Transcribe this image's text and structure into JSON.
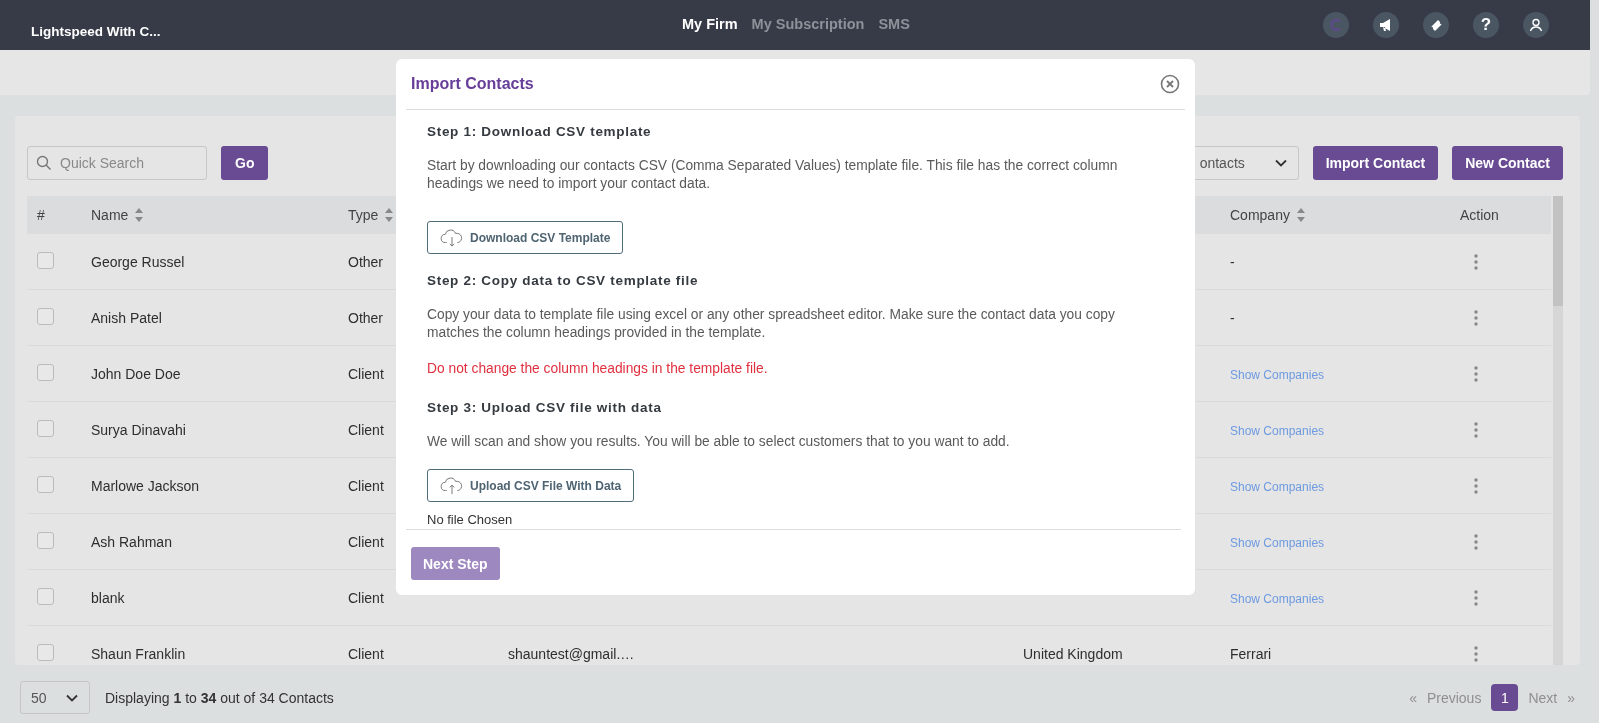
{
  "top_bar": {
    "brand": "Lightspeed With C...",
    "nav": [
      {
        "label": "My Firm",
        "selected": true
      },
      {
        "label": "My Subscription",
        "selected": false
      },
      {
        "label": "SMS",
        "selected": false
      }
    ],
    "help_glyph": "?"
  },
  "toolbar": {
    "search": {
      "placeholder": "Quick Search"
    },
    "go": "Go",
    "filter": "ontacts",
    "buttons": [
      "Import Contact",
      "New Contact"
    ]
  },
  "table": {
    "columns": [
      {
        "label": "#",
        "sortable": false
      },
      {
        "label": "Name",
        "sortable": true
      },
      {
        "label": "Type",
        "sortable": true
      },
      {
        "label": "Company",
        "sortable": true
      },
      {
        "label": "Action",
        "sortable": false
      }
    ],
    "rows": [
      {
        "checked": false,
        "name": "George Russel",
        "type": "Other",
        "company": "-",
        "company_link": false
      },
      {
        "checked": false,
        "name": "Anish Patel",
        "type": "Other",
        "company": "-",
        "company_link": false
      },
      {
        "checked": false,
        "name": "John Doe Doe",
        "type": "Client",
        "company": "Show Companies",
        "company_link": true
      },
      {
        "checked": false,
        "name": "Surya Dinavahi",
        "type": "Client",
        "company": "Show Companies",
        "company_link": true
      },
      {
        "checked": false,
        "name": "Marlowe Jackson",
        "type": "Client",
        "company": "Show Companies",
        "company_link": true
      },
      {
        "checked": false,
        "name": "Ash Rahman",
        "type": "Client",
        "company": "Show Companies",
        "company_link": true
      },
      {
        "checked": false,
        "name": "blank",
        "type": "Client",
        "company": "Show Companies",
        "company_link": true
      },
      {
        "checked": false,
        "name": "Shaun Franklin",
        "type": "Client",
        "email": "shauntest@gmail.…",
        "country": "United Kingdom",
        "company": "Ferrari",
        "company_link": false
      }
    ]
  },
  "footer": {
    "page_size": "50",
    "summary": "Displaying **1** to **34** out of 34 Contacts",
    "pagination": {
      "prev_arrow": "«",
      "prev": "Previous",
      "prev_disabled": true,
      "pages": [
        {
          "label": "1",
          "selected": true
        }
      ],
      "next": "Next",
      "next_disabled": true,
      "next_arrow": "»"
    }
  },
  "modal": {
    "title": "Import Contacts",
    "body": [
      {
        "kind": "heading",
        "text": "Step 1: Download CSV template"
      },
      {
        "kind": "paragraph",
        "text": "Start by downloading our contacts CSV (Comma Separated Values) template file. This file has the correct column headings we need to import your contact data."
      },
      {
        "kind": "download",
        "text": "Download CSV Template"
      },
      {
        "kind": "heading",
        "text": "Step 2: Copy data to CSV template file"
      },
      {
        "kind": "paragraph",
        "text": "Copy your data to template file using excel or any other spreadsheet editor. Make sure the contact data you copy matches the column headings provided in the template."
      },
      {
        "kind": "warning",
        "text": "Do not change the column headings in the template file."
      },
      {
        "kind": "heading",
        "text": "Step 3: Upload CSV file with data"
      },
      {
        "kind": "paragraph",
        "text": "We will scan and show you results. You will be able to select customers that to you want to add."
      },
      {
        "kind": "upload",
        "text": "Upload CSV File With Data"
      },
      {
        "kind": "status",
        "text": "No file Chosen"
      }
    ],
    "next": {
      "label": "Next Step",
      "disabled": true
    }
  }
}
